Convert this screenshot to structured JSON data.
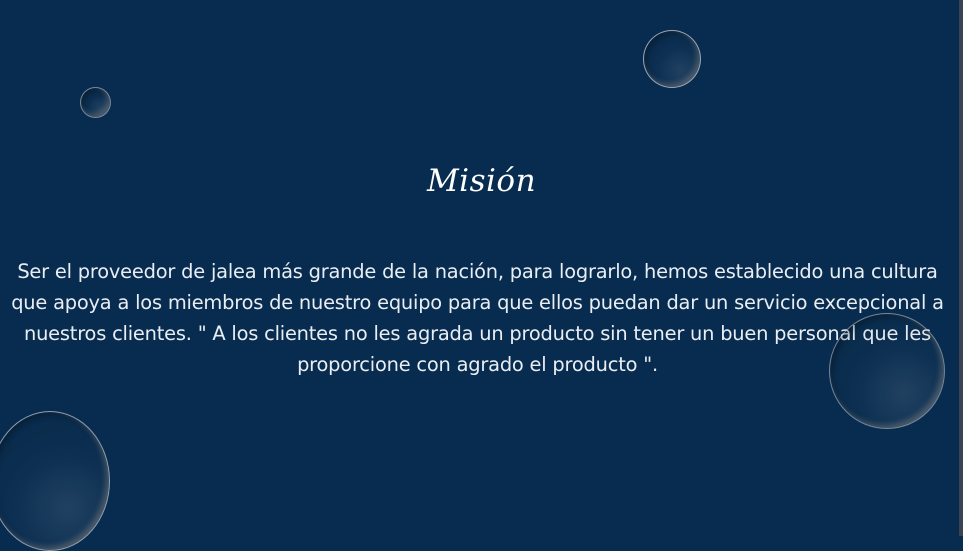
{
  "mission": {
    "title": "Misión",
    "text": "Ser el proveedor de jalea más grande de la nación,  para lograrlo, hemos  establecido una cultura que apoya a los miembros de nuestro equipo para que ellos puedan dar un servicio excepcional a nuestros clientes. \" A los clientes no les agrada un producto sin tener un buen personal que les proporcione con agrado el producto \"."
  },
  "colors": {
    "background": "#082c4f",
    "text": "#ffffff"
  }
}
